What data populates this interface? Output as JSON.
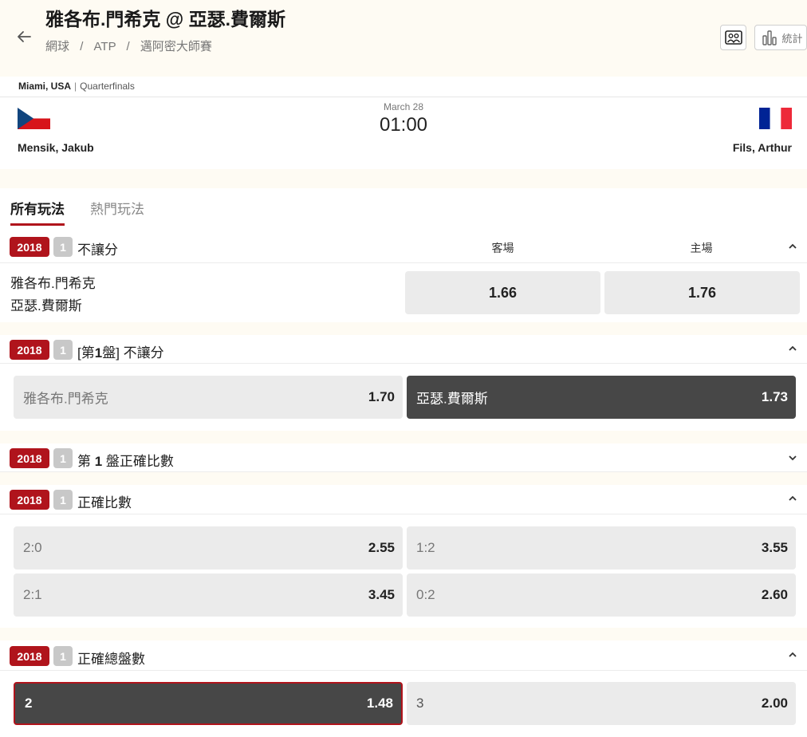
{
  "header": {
    "title": "雅各布.門希克 @ 亞瑟.費爾斯",
    "breadcrumb": [
      "網球",
      "ATP",
      "邁阿密大師賽"
    ],
    "breadcrumb_sep": "/",
    "stats_label": "統計"
  },
  "match": {
    "venue": "Miami, USA",
    "round": "Quarterfinals",
    "date": "March 28",
    "time": "01:00",
    "home_team": "Mensik, Jakub",
    "away_team": "Fils, Arthur"
  },
  "tabs": [
    "所有玩法",
    "熱門玩法"
  ],
  "markets": [
    {
      "year": "2018",
      "num": "1",
      "title": "不讓分",
      "col_away": "客場",
      "col_home": "主場",
      "teams": [
        "雅各布.門希克",
        "亞瑟.費爾斯"
      ],
      "odds": [
        "1.66",
        "1.76"
      ]
    },
    {
      "year": "2018",
      "num": "1",
      "title_prefix": "[第",
      "title_bold": "1",
      "title_suffix": "盤] 不讓分",
      "selections": [
        {
          "label": "雅各布.門希克",
          "price": "1.70"
        },
        {
          "label": "亞瑟.費爾斯",
          "price": "1.73"
        }
      ]
    },
    {
      "year": "2018",
      "num": "1",
      "title_prefix": "第 ",
      "title_bold": "1",
      "title_suffix": " 盤正確比數"
    },
    {
      "year": "2018",
      "num": "1",
      "title": "正確比數",
      "selections": [
        {
          "label": "2:0",
          "price": "2.55"
        },
        {
          "label": "1:2",
          "price": "3.55"
        },
        {
          "label": "2:1",
          "price": "3.45"
        },
        {
          "label": "0:2",
          "price": "2.60"
        }
      ]
    },
    {
      "year": "2018",
      "num": "1",
      "title": "正確總盤數",
      "selections": [
        {
          "label": "2",
          "price": "1.48"
        },
        {
          "label": "3",
          "price": "2.00"
        }
      ]
    }
  ],
  "colors": {
    "accent_red": "#b0141c",
    "selected_bg": "#474747",
    "button_bg": "#ebebeb",
    "band_bg": "#fefbf3",
    "flag_cz_blue": "#11457e",
    "flag_cz_red": "#d7141a",
    "flag_fr_blue": "#002395",
    "flag_fr_red": "#ed2939"
  },
  "icons": {
    "back": "arrow-left-icon",
    "scoreboard": "scoreboard-icon",
    "stats": "bar-chart-icon",
    "expand": "chevron-up-icon",
    "collapse": "chevron-down-icon"
  }
}
